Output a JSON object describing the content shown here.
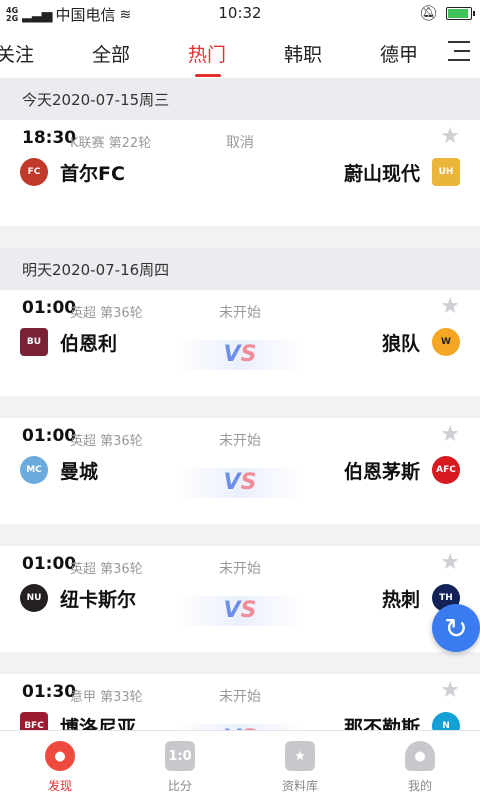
{
  "status_bar": {
    "carrier": "中国电信",
    "time": "10:32"
  },
  "tabs": [
    {
      "label": "关注"
    },
    {
      "label": "全部"
    },
    {
      "label": "热门"
    },
    {
      "label": "韩职"
    },
    {
      "label": "德甲"
    }
  ],
  "groups": [
    {
      "date": "今天2020-07-15周三",
      "matches": [
        {
          "time": "18:30",
          "league": "K联赛 第22轮",
          "status": "取消",
          "home": "首尔FC",
          "away": "蔚山现代",
          "show_vs": false
        }
      ]
    },
    {
      "date": "明天2020-07-16周四",
      "matches": [
        {
          "time": "01:00",
          "league": "英超 第36轮",
          "status": "未开始",
          "home": "伯恩利",
          "away": "狼队",
          "show_vs": true
        },
        {
          "time": "01:00",
          "league": "英超 第36轮",
          "status": "未开始",
          "home": "曼城",
          "away": "伯恩茅斯",
          "show_vs": true
        },
        {
          "time": "01:00",
          "league": "英超 第36轮",
          "status": "未开始",
          "home": "纽卡斯尔",
          "away": "热刺",
          "show_vs": true
        },
        {
          "time": "01:30",
          "league": "意甲 第33轮",
          "status": "未开始",
          "home": "博洛尼亚",
          "away": "那不勒斯",
          "show_vs": true
        }
      ]
    }
  ],
  "vs_label": {
    "v": "V",
    "s": "S"
  },
  "bottom_nav": [
    {
      "label": "发现",
      "icon": "planet-icon",
      "active": true
    },
    {
      "label": "比分",
      "icon": "scoreboard-icon",
      "glyph": "1:0",
      "active": false
    },
    {
      "label": "资料库",
      "icon": "database-icon",
      "active": false
    },
    {
      "label": "我的",
      "icon": "profile-icon",
      "active": false
    }
  ],
  "colors": {
    "accent": "#e53030",
    "fab": "#3a7cf0"
  }
}
